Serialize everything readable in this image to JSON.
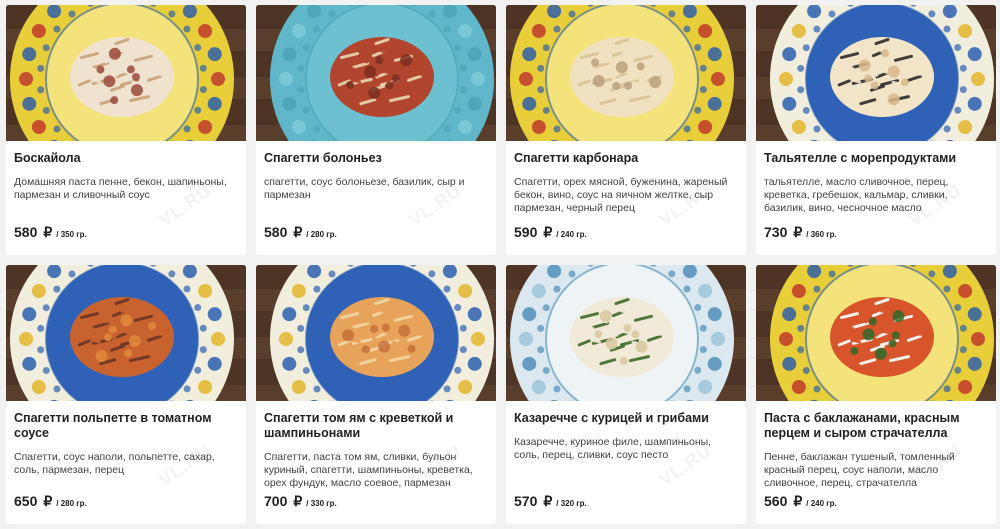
{
  "watermark": "VL.RU",
  "currency": "₽",
  "items": [
    {
      "title": "Боскайола",
      "desc": "Домашняя паста пенне, бекон, шапиньоны, пармезан и сливочный соус",
      "price": "580",
      "weight": "/ 350 гр.",
      "plate": "yellow",
      "food": "creamy"
    },
    {
      "title": "Спагетти болоньез",
      "desc": "спагетти, соус болоньезе, базилик, сыр и пармезан",
      "price": "580",
      "weight": "/ 280 гр.",
      "plate": "teal",
      "food": "bolognese"
    },
    {
      "title": "Спагетти карбонара",
      "desc": "Спагетти, орех мясной, буженина, жареный бекон, вино, соус на яичном желтке, сыр пармезан, черный перец",
      "price": "590",
      "weight": "/ 240 гр.",
      "plate": "yellow",
      "food": "carbonara"
    },
    {
      "title": "Тальятелле с морепродуктами",
      "desc": "тальятелле, масло сливочное, перец, креветка, гребешок, кальмар, сливки, базилик, вино, чесночное масло",
      "price": "730",
      "weight": "/ 360 гр.",
      "plate": "blue",
      "food": "seafood"
    },
    {
      "title": "Спагетти польпетте в томатном соусе",
      "desc": "Спагетти, соус наполи, польпетте, сахар, соль, пармезан, перец",
      "price": "650",
      "weight": "/ 280 гр.",
      "plate": "blue",
      "food": "meatballs"
    },
    {
      "title": "Спагетти том ям с креветкой и шампиньонами",
      "desc": "Спагетти, паста том ям, сливки, бульон куриный, спагетти, шампиньоны, креветка, орех фундук, масло соевое, пармезан",
      "price": "700",
      "weight": "/ 330 гр.",
      "plate": "blue",
      "food": "tomyam"
    },
    {
      "title": "Казаречче с курицей и грибами",
      "desc": "Казаречче, куриное филе, шампиньоны, соль, перец, сливки, соус песто",
      "price": "570",
      "weight": "/ 320 гр.",
      "plate": "lightblue",
      "food": "pesto"
    },
    {
      "title": "Паста с баклажанами, красным перцем и сыром страчателла",
      "desc": "Пенне, баклажан тушеный, томленный красный перец, соус наполи, масло сливочное, перец, страчателла",
      "price": "560",
      "weight": "/ 240 гр.",
      "plate": "yellow",
      "food": "penne"
    }
  ]
}
